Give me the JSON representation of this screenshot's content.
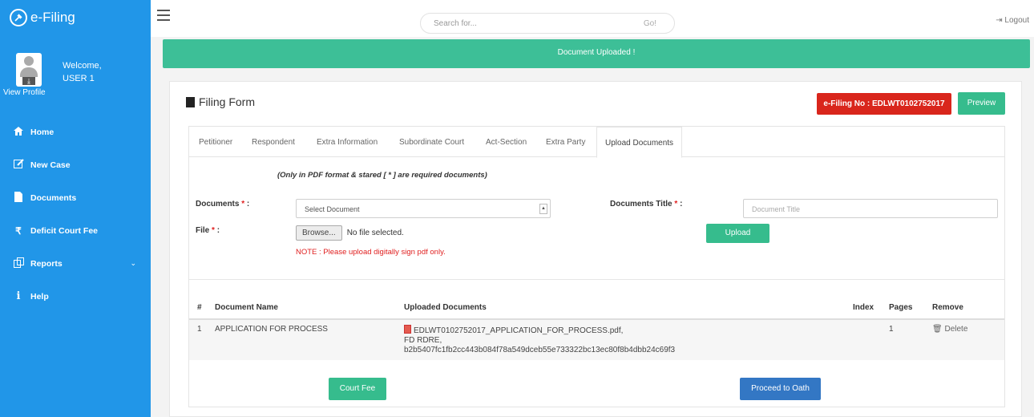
{
  "brand": {
    "title": "e-Filing"
  },
  "profile": {
    "welcome": "Welcome,",
    "user": "USER 1",
    "view_profile": "View Profile"
  },
  "sidebar": {
    "items": [
      {
        "label": "Home",
        "icon": "home-icon"
      },
      {
        "label": "New Case",
        "icon": "edit-icon"
      },
      {
        "label": "Documents",
        "icon": "file-icon"
      },
      {
        "label": "Deficit Court Fee",
        "icon": "rupee-icon"
      },
      {
        "label": "Reports",
        "icon": "copy-icon"
      },
      {
        "label": "Help",
        "icon": "info-icon"
      }
    ]
  },
  "topbar": {
    "search_placeholder": "Search for...",
    "go": "Go!",
    "logout": "Logout"
  },
  "alert": {
    "text": "Document Uploaded !"
  },
  "form": {
    "title": "Filing Form",
    "efiling_no": "e-Filing No : EDLWT0102752017",
    "preview": "Preview",
    "tabs": [
      "Petitioner",
      "Respondent",
      "Extra Information",
      "Subordinate Court",
      "Act-Section",
      "Extra Party",
      "Upload Documents"
    ],
    "note_top": "(Only in PDF format & stared [ * ] are required documents)",
    "documents_label": "Documents",
    "documents_select": "Select Document",
    "documents_title_label": "Documents Title",
    "documents_title_placeholder": "Document Title",
    "file_label": "File",
    "browse": "Browse...",
    "no_file": "No file selected.",
    "note_red": "NOTE : Please upload digitally sign pdf only.",
    "upload": "Upload",
    "required_mark": "*",
    "colon": ":",
    "table": {
      "headers": [
        "#",
        "Document Name",
        "Uploaded Documents",
        "Index",
        "Pages",
        "Remove"
      ],
      "rows": [
        {
          "num": "1",
          "name": "APPLICATION FOR PROCESS",
          "file": "EDLWT0102752017_APPLICATION_FOR_PROCESS.pdf,",
          "line2": "FD RDRE,",
          "hash": "b2b5407fc1fb2cc443b084f78a549dceb55e733322bc13ec80f8b4dbb24c69f3",
          "index": "",
          "pages": "1",
          "remove": "Delete"
        }
      ]
    },
    "court_fee": "Court Fee",
    "proceed": "Proceed to Oath"
  }
}
